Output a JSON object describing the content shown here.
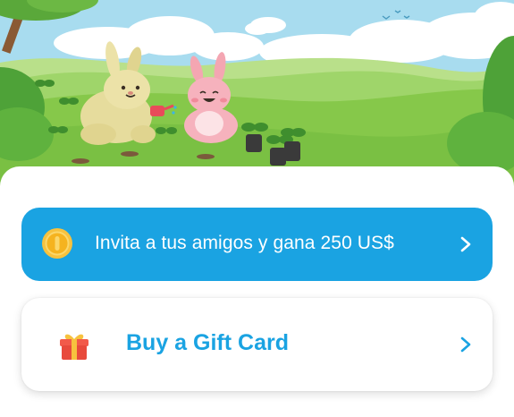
{
  "invite_card": {
    "label": "Invita a tus amigos y gana 250 US$",
    "icon": "coin-icon",
    "chevron": "chevron-right-icon"
  },
  "gift_card": {
    "label": "Buy a Gift Card",
    "icon": "gift-icon",
    "chevron": "chevron-right-icon"
  },
  "colors": {
    "accent": "#1aa3e2",
    "card_text": "#ffffff",
    "sky": "#a7dcef",
    "grass": "#8fcf4a"
  }
}
